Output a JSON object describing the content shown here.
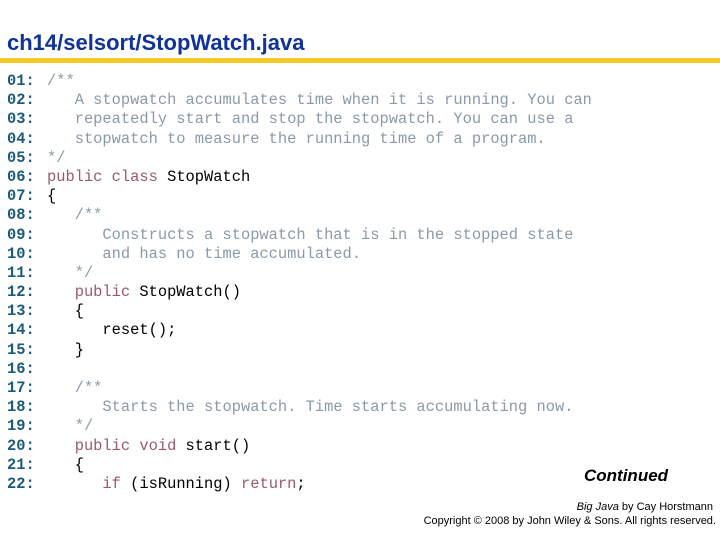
{
  "title": "ch14/selsort/StopWatch.java",
  "code_lines": [
    {
      "num": "01:",
      "tokens": [
        {
          "t": "/**",
          "c": "cm"
        }
      ]
    },
    {
      "num": "02:",
      "tokens": [
        {
          "t": "   A stopwatch accumulates time when it is running. You can",
          "c": "cm"
        }
      ]
    },
    {
      "num": "03:",
      "tokens": [
        {
          "t": "   repeatedly start and stop the stopwatch. You can use a",
          "c": "cm"
        }
      ]
    },
    {
      "num": "04:",
      "tokens": [
        {
          "t": "   stopwatch to measure the running time of a program.",
          "c": "cm"
        }
      ]
    },
    {
      "num": "05:",
      "tokens": [
        {
          "t": "*/",
          "c": "cm"
        }
      ]
    },
    {
      "num": "06:",
      "tokens": [
        {
          "t": "public class ",
          "c": "kw"
        },
        {
          "t": "StopWatch",
          "c": "pl"
        }
      ]
    },
    {
      "num": "07:",
      "tokens": [
        {
          "t": "{",
          "c": "pl"
        }
      ]
    },
    {
      "num": "08:",
      "tokens": [
        {
          "t": "   /**",
          "c": "cm"
        }
      ]
    },
    {
      "num": "09:",
      "tokens": [
        {
          "t": "      Constructs a stopwatch that is in the stopped state",
          "c": "cm"
        }
      ]
    },
    {
      "num": "10:",
      "tokens": [
        {
          "t": "      and has no time accumulated.",
          "c": "cm"
        }
      ]
    },
    {
      "num": "11:",
      "tokens": [
        {
          "t": "   */",
          "c": "cm"
        }
      ]
    },
    {
      "num": "12:",
      "tokens": [
        {
          "t": "   public ",
          "c": "kw"
        },
        {
          "t": "StopWatch()",
          "c": "pl"
        }
      ]
    },
    {
      "num": "13:",
      "tokens": [
        {
          "t": "   {",
          "c": "pl"
        }
      ]
    },
    {
      "num": "14:",
      "tokens": [
        {
          "t": "      reset();",
          "c": "pl"
        }
      ]
    },
    {
      "num": "15:",
      "tokens": [
        {
          "t": "   }",
          "c": "pl"
        }
      ]
    },
    {
      "num": "16:",
      "tokens": [
        {
          "t": "",
          "c": "pl"
        }
      ]
    },
    {
      "num": "17:",
      "tokens": [
        {
          "t": "   /**",
          "c": "cm"
        }
      ]
    },
    {
      "num": "18:",
      "tokens": [
        {
          "t": "      Starts the stopwatch. Time starts accumulating now.",
          "c": "cm"
        }
      ]
    },
    {
      "num": "19:",
      "tokens": [
        {
          "t": "   */",
          "c": "cm"
        }
      ]
    },
    {
      "num": "20:",
      "tokens": [
        {
          "t": "   public void ",
          "c": "kw"
        },
        {
          "t": "start()",
          "c": "pl"
        }
      ]
    },
    {
      "num": "21:",
      "tokens": [
        {
          "t": "   {",
          "c": "pl"
        }
      ]
    },
    {
      "num": "22:",
      "tokens": [
        {
          "t": "      ",
          "c": "pl"
        },
        {
          "t": "if",
          "c": "kw"
        },
        {
          "t": " (isRunning) ",
          "c": "pl"
        },
        {
          "t": "return",
          "c": "kw"
        },
        {
          "t": ";",
          "c": "pl"
        }
      ]
    }
  ],
  "continued": "Continued",
  "footer": {
    "book_title": "Big Java",
    "by_author": " by Cay Horstmann",
    "copyright": "Copyright © 2008 by John Wiley & Sons.  All rights reserved."
  },
  "colors": {
    "title": "#0f3399",
    "rule": "#f7c923",
    "line_number": "#1a5a7a",
    "comment": "#8a9aa8",
    "keyword": "#9a5a6a"
  }
}
